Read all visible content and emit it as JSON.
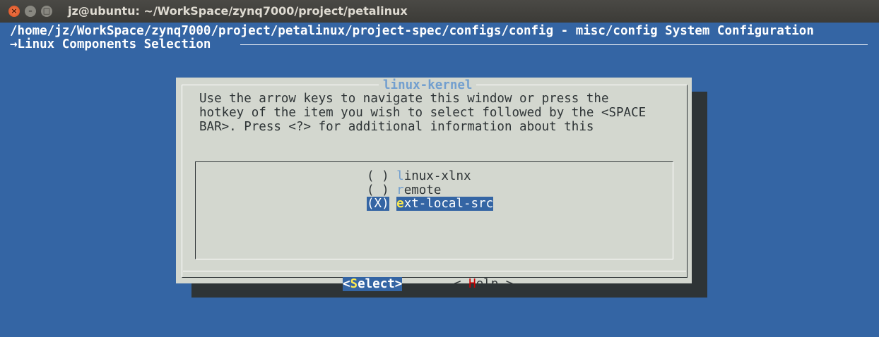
{
  "window": {
    "title": "jz@ubuntu: ~/WorkSpace/zynq7000/project/petalinux"
  },
  "header": {
    "path_line": "/home/jz/WorkSpace/zynq7000/project/petalinux/project-spec/configs/config - misc/config System Configuration",
    "breadcrumb": "→Linux Components Selection"
  },
  "dialog": {
    "title": "linux-kernel",
    "help_lines": [
      "Use the arrow keys to navigate this window or press the",
      "hotkey of the item you wish to select followed by the <SPACE",
      "BAR>. Press <?> for additional information about this"
    ],
    "options": [
      {
        "marker": "( )",
        "hotkey": "l",
        "rest": "inux-xlnx",
        "selected": false
      },
      {
        "marker": "( )",
        "hotkey": "r",
        "rest": "emote",
        "selected": false
      },
      {
        "marker": "(X)",
        "hotkey": "e",
        "rest": "xt-local-src",
        "selected": true
      }
    ],
    "buttons": {
      "select": {
        "pre": "<",
        "hotkey": "S",
        "rest": "elect>"
      },
      "help": {
        "pre": "< ",
        "hotkey": "H",
        "rest": "elp >"
      }
    }
  },
  "colors": {
    "background": "#3465a4",
    "dialog_bg": "#d3d7cf",
    "highlight": "#3465a4",
    "hotkey": "#fce94f"
  }
}
